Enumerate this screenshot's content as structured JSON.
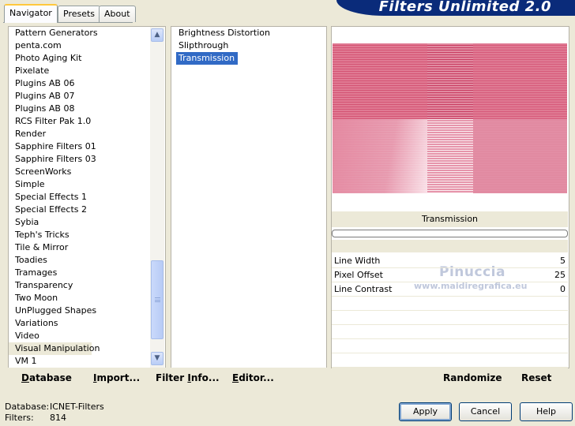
{
  "tabs": [
    "Navigator",
    "Presets",
    "About"
  ],
  "banner_title": "Filters Unlimited 2.0",
  "categories": [
    "Pattern Generators",
    "penta.com",
    "Photo Aging Kit",
    "Pixelate",
    "Plugins AB 06",
    "Plugins AB 07",
    "Plugins AB 08",
    "RCS Filter Pak 1.0",
    "Render",
    "Sapphire Filters 01",
    "Sapphire Filters 03",
    "ScreenWorks",
    "Simple",
    "Special Effects 1",
    "Special Effects 2",
    "Sybia",
    "Teph's Tricks",
    "Tile & Mirror",
    "Toadies",
    "Tramages",
    "Transparency",
    "Two Moon",
    "UnPlugged Shapes",
    "Variations",
    "Video",
    "Visual Manipulation",
    "VM 1"
  ],
  "selected_category": "Visual Manipulation",
  "filters": [
    "Brightness Distortion",
    "Slipthrough",
    "Transmission"
  ],
  "selected_filter": "Transmission",
  "toolbar": {
    "database_label": "Database",
    "import_label": "Import...",
    "filter_info_label": "Filter Info...",
    "editor_label": "Editor..."
  },
  "preview_filter_name": "Transmission",
  "params": [
    {
      "label": "Line Width",
      "value": "5"
    },
    {
      "label": "Pixel Offset",
      "value": "25"
    },
    {
      "label": "Line Contrast",
      "value": "0"
    }
  ],
  "watermark": {
    "name": "Pinuccia",
    "site": "www.maidiregrafica.eu"
  },
  "right_buttons": {
    "randomize": "Randomize",
    "reset": "Reset"
  },
  "status": {
    "database_label": "Database:",
    "database_value": "ICNET-Filters",
    "filters_label": "Filters:",
    "filters_value": "814"
  },
  "dialog_buttons": {
    "apply": "Apply",
    "cancel": "Cancel",
    "help": "Help"
  },
  "colors": {
    "selection": "#316ac5",
    "banner": "#0a2b7a",
    "preview_pink": "#d9627f"
  }
}
